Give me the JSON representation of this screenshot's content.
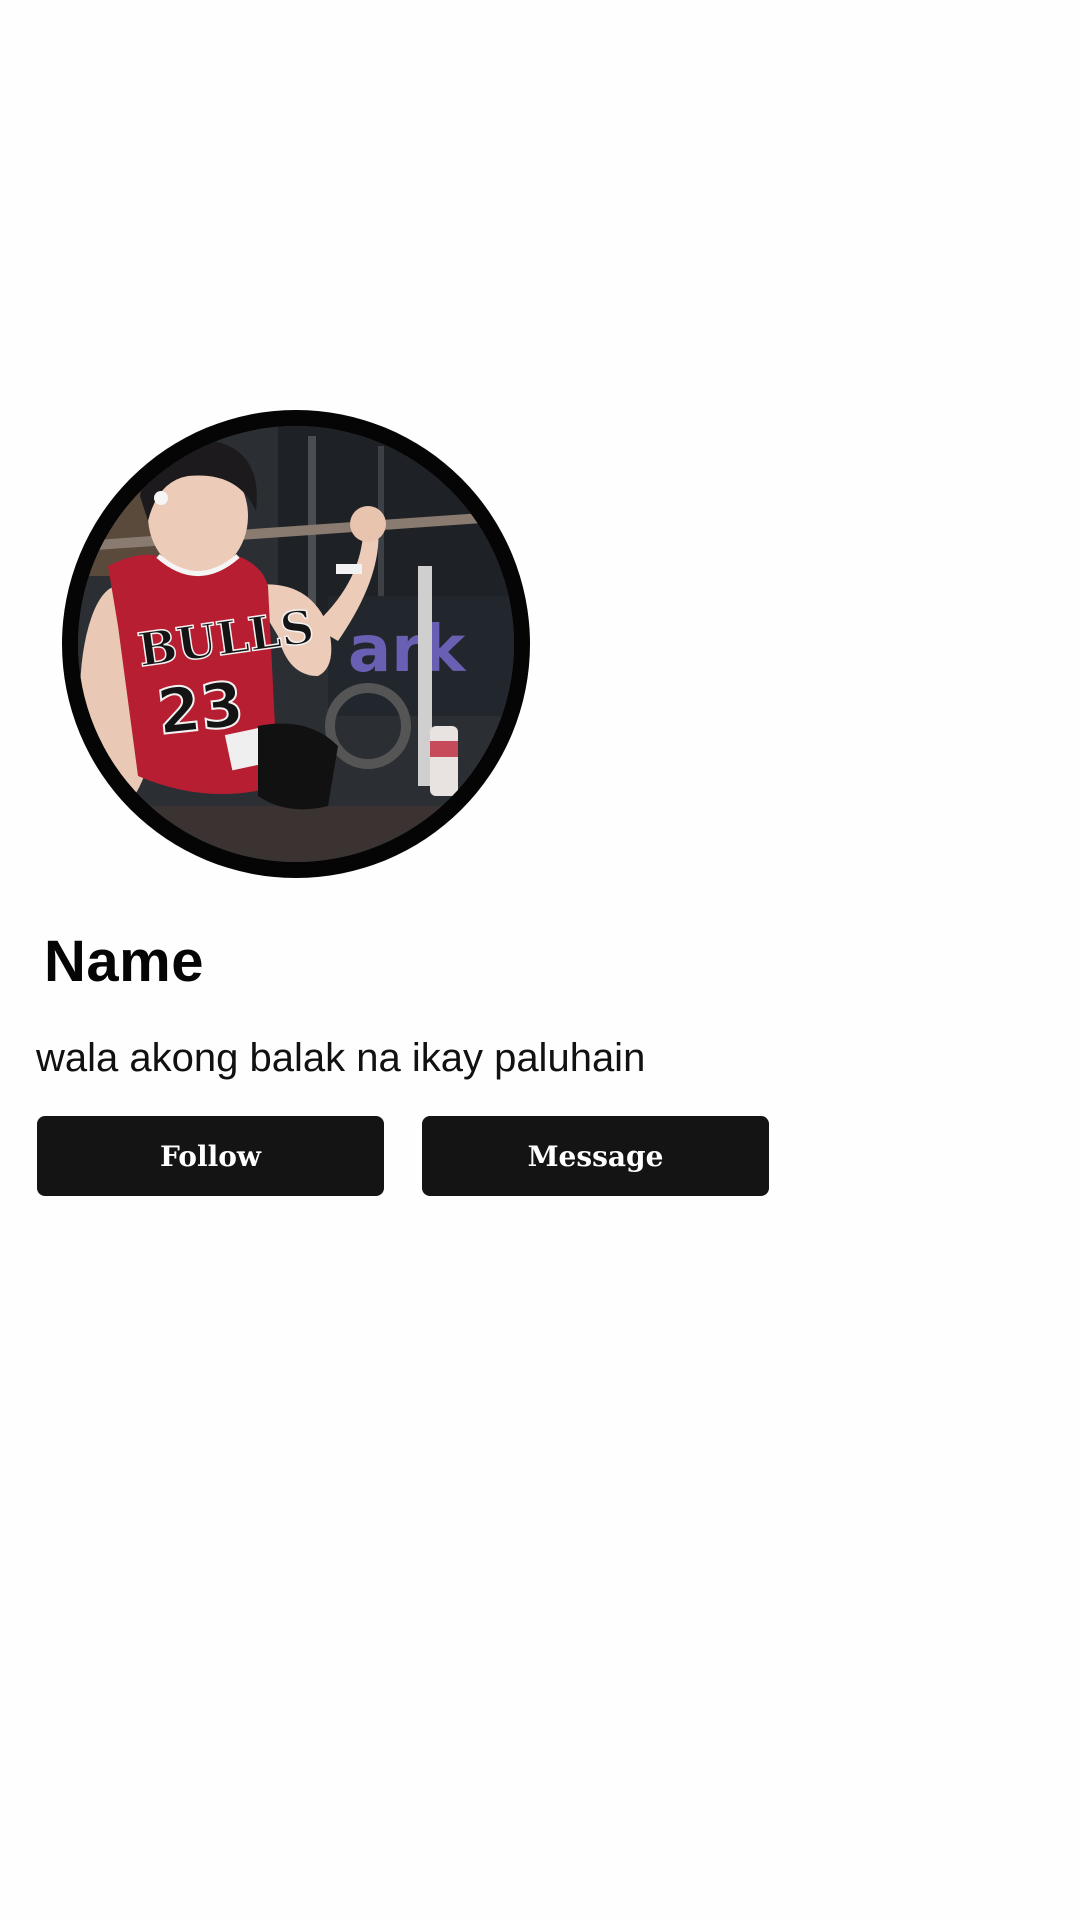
{
  "profile": {
    "name": "Name",
    "bio": "wala akong balak na ikay paluhain",
    "avatar_alt": "profile photo"
  },
  "actions": {
    "follow_label": "Follow",
    "message_label": "Message"
  },
  "colors": {
    "background": "#fefefe",
    "button": "#141414",
    "button_text": "#ffffff",
    "ring": "#050505"
  }
}
